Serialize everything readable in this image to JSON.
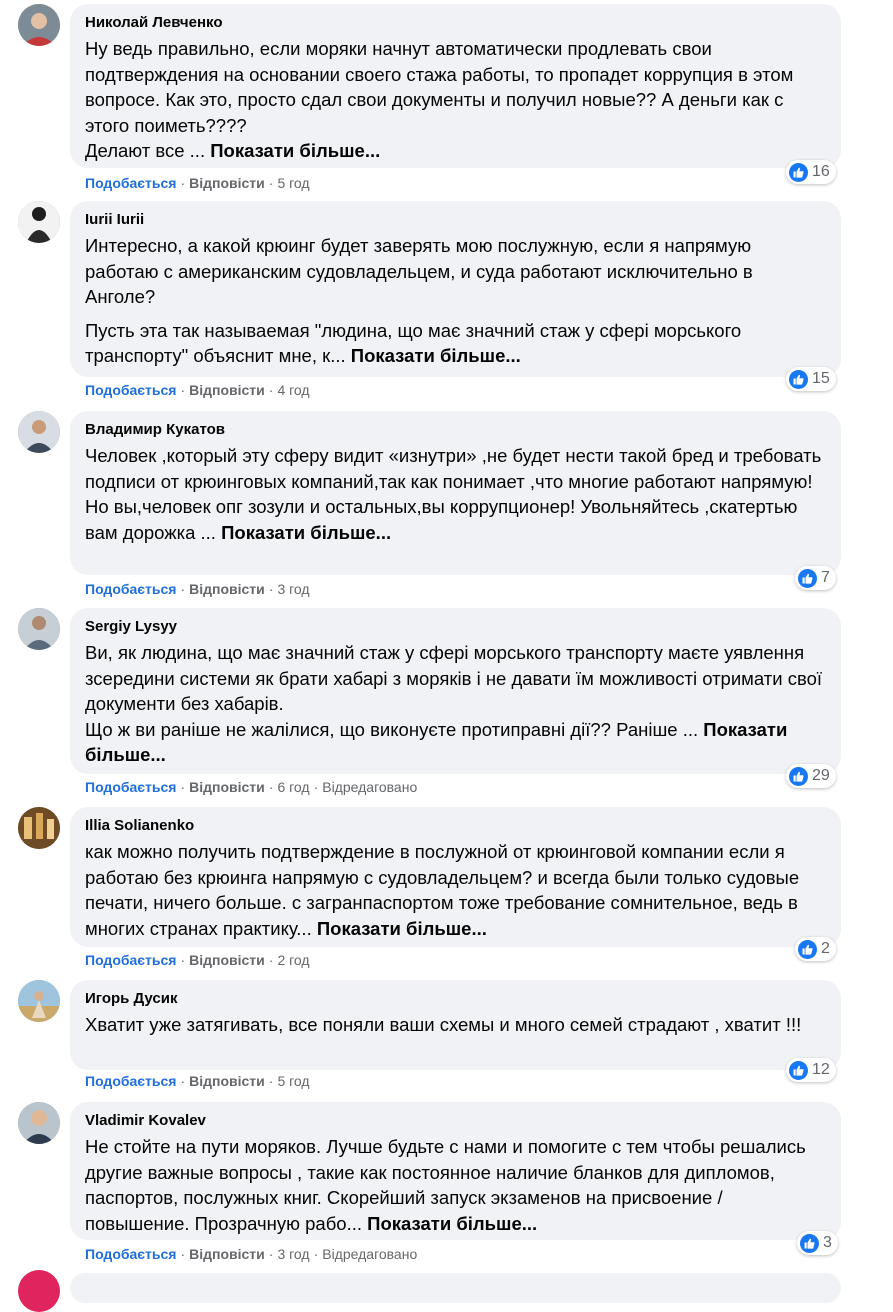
{
  "actions": {
    "like_label": "Подобається",
    "reply_label": "Відповісти",
    "separator": "·",
    "edited_label": "Відредаговано"
  },
  "more_label": "Показати більше...",
  "colors": {
    "bubble": "#f0f2f5",
    "like_blue": "#216fdb",
    "meta_gray": "#65676b",
    "reaction_blue": "#1877f2"
  },
  "comments": [
    {
      "author": "Николай Левченко",
      "paragraphs": [
        "Ну ведь правильно, если моряки начнут автоматически продлевать свои подтверждения на основании своего стажа работы, то пропадет коррупция в этом вопросе. Как это, просто сдал свои документы и получил новые?? А деньги как с этого поиметь????",
        "Делают все ..."
      ],
      "time": "5 год",
      "reactions": "16"
    },
    {
      "author": "Iurii Iurii",
      "paragraphs": [
        "Интересно, а какой крюинг будет заверять мою послужную, если я напрямую работаю с американским судовладельцем, и суда работают исключительно в Анголе?",
        "Пусть эта так называемая \"людина, що має значний стаж у сфері морського транспорту\" объяснит мне, к..."
      ],
      "time": "4 год",
      "reactions": "15"
    },
    {
      "author": "Владимир Кукатов",
      "paragraphs": [
        "Человек ,который эту сферу видит «изнутри» ,не будет нести такой бред и требовать подписи от крюинговых компаний,так как понимает ,что многие работают напрямую!",
        "Но вы,человек опг зозули и остальных,вы коррупционер! Увольняйтесь ,скатертью вам дорожка ..."
      ],
      "time": "3 год",
      "reactions": "7"
    },
    {
      "author": "Sergiy Lysyy",
      "paragraphs": [
        "Ви, як людина, що має значний стаж у сфері морського транспорту маєте уявлення зсередини системи як брати хабарі з моряків і не давати їм можливості отримати свої документи без хабарів.",
        "Що ж ви раніше не жалілися, що виконуєте протиправні дії?? Раніше ..."
      ],
      "time": "6 год",
      "edited": true,
      "reactions": "29"
    },
    {
      "author": "Illia Solianenko",
      "paragraphs": [
        "как можно получить подтверждение в послужной от крюинговой компании если я работаю без крюинга напрямую с судовладельцем? и всегда были только судовые печати, ничего больше. с загранпаспортом тоже требование сомнительное, ведь в многих странах практику..."
      ],
      "time": "2 год",
      "reactions": "2"
    },
    {
      "author": "Игорь Дусик",
      "paragraphs": [
        "Хватит уже затягивать, все поняли ваши схемы и много семей страдают , хватит !!!"
      ],
      "time": "5 год",
      "reactions": "12"
    },
    {
      "author": "Vladimir Kovalev",
      "paragraphs": [
        "Не стойте на пути моряков. Лучше будьте с нами и помогите с тем чтобы решались другие важные вопросы , такие как постоянное наличие бланков для дипломов, паспортов, послужных книг. Скорейший запуск экзаменов на присвоение / повышение. Прозрачную рабо..."
      ],
      "time": "3 год",
      "edited": true,
      "reactions": "3"
    }
  ]
}
